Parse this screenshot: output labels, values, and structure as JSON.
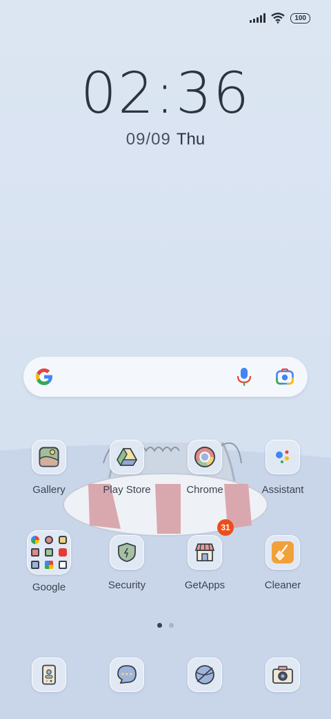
{
  "status": {
    "battery": "100"
  },
  "clock": {
    "hour": "02",
    "minute": "36"
  },
  "date": {
    "monthday": "09/09",
    "weekday": "Thu"
  },
  "search": {
    "icons": [
      "google-g-icon",
      "mic-icon",
      "lens-icon"
    ]
  },
  "apps": {
    "row1": [
      {
        "label": "Gallery",
        "icon": "gallery-icon"
      },
      {
        "label": "Play Store",
        "icon": "play-store-icon"
      },
      {
        "label": "Chrome",
        "icon": "chrome-icon"
      },
      {
        "label": "Assistant",
        "icon": "assistant-icon"
      }
    ],
    "row2": [
      {
        "label": "Google",
        "icon": "google-folder"
      },
      {
        "label": "Security",
        "icon": "security-icon"
      },
      {
        "label": "GetApps",
        "icon": "getapps-icon",
        "badge": "31"
      },
      {
        "label": "Cleaner",
        "icon": "cleaner-icon"
      }
    ]
  },
  "dock": [
    "phone-icon",
    "messages-icon",
    "browser-icon",
    "camera-icon"
  ],
  "pager": {
    "pages": 2,
    "current": 1
  },
  "colors": {
    "badge": "#ea4e1b",
    "text": "#3d4350",
    "accent_orange": "#f2a03a"
  }
}
